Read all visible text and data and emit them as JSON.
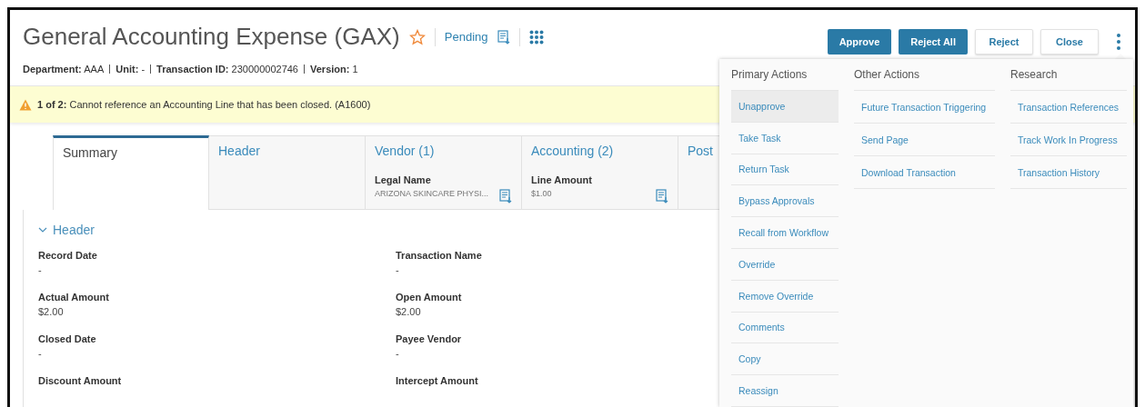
{
  "title": "General Accounting Expense (GAX)",
  "status": "Pending",
  "meta": [
    {
      "label": "Department:",
      "value": "AAA"
    },
    {
      "label": "Unit:",
      "value": "-"
    },
    {
      "label": "Transaction ID:",
      "value": "230000002746"
    },
    {
      "label": "Version:",
      "value": "1"
    }
  ],
  "alert": {
    "count": "1 of 2:",
    "message": "Cannot reference an Accounting Line that has been closed. (A1600)"
  },
  "actions": [
    {
      "label": "Approve",
      "kind": "primary"
    },
    {
      "label": "Reject All",
      "kind": "primary"
    },
    {
      "label": "Reject",
      "kind": "secondary"
    },
    {
      "label": "Close",
      "kind": "secondary"
    }
  ],
  "tabs": [
    {
      "label": "Summary",
      "selected": true
    },
    {
      "label": "Header",
      "selected": false
    },
    {
      "label": "Vendor (1)",
      "selected": false,
      "field_label": "Legal Name",
      "field_value": "ARIZONA SKINCARE PHYSI..."
    },
    {
      "label": "Accounting (2)",
      "selected": false,
      "field_label": "Line Amount",
      "field_value": "$1.00"
    },
    {
      "label": "Post",
      "selected": false
    }
  ],
  "section": {
    "title": "Header",
    "expanded": true,
    "fields": [
      {
        "label": "Record Date",
        "value": "-"
      },
      {
        "label": "Transaction Name",
        "value": "-"
      },
      {
        "label": "Actual Amount",
        "value": "$2.00"
      },
      {
        "label": "Open Amount",
        "value": "$2.00"
      },
      {
        "label": "Closed Date",
        "value": "-"
      },
      {
        "label": "Payee Vendor",
        "value": "-"
      },
      {
        "label": "Discount Amount"
      },
      {
        "label": "Intercept Amount"
      }
    ]
  },
  "menu": {
    "columns": [
      {
        "title": "Primary Actions",
        "items": [
          {
            "label": "Unapprove",
            "selected": true
          },
          {
            "label": "Take Task",
            "selected": false
          },
          {
            "label": "Return Task",
            "selected": false
          },
          {
            "label": "Bypass Approvals",
            "selected": false
          },
          {
            "label": "Recall from Workflow",
            "selected": false
          },
          {
            "label": "Override",
            "selected": false
          },
          {
            "label": "Remove Override",
            "selected": false
          },
          {
            "label": "Comments",
            "selected": false
          },
          {
            "label": "Copy",
            "selected": false
          },
          {
            "label": "Reassign",
            "selected": false
          }
        ]
      },
      {
        "title": "Other Actions",
        "items": [
          {
            "label": "Future Transaction Triggering",
            "selected": false
          },
          {
            "label": "Send Page",
            "selected": false
          },
          {
            "label": "Download Transaction",
            "selected": false
          }
        ]
      },
      {
        "title": "Research",
        "items": [
          {
            "label": "Transaction References",
            "selected": false
          },
          {
            "label": "Track Work In Progress",
            "selected": false
          },
          {
            "label": "Transaction History",
            "selected": false
          }
        ]
      }
    ]
  }
}
